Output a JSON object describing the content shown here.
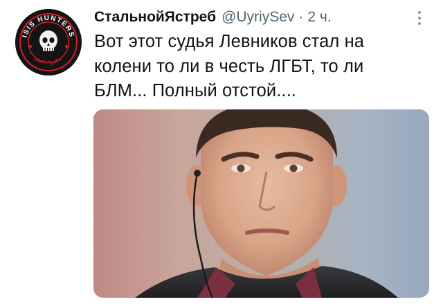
{
  "tweet": {
    "author": {
      "display_name": "СтальнойЯстреб",
      "handle": "@UyriySev",
      "avatar_icon": "skull-badge-avatar",
      "avatar_text_top": "ISIS HUNTERS",
      "avatar_text_bottom": "صائدوا داعش"
    },
    "separator": "·",
    "time": "2 ч.",
    "text": "Вот этот судья Левников стал на колени то ли в честь ЛГБТ, то ли БЛМ... Полный отстой....",
    "more_icon": "more-vertical-icon",
    "media": {
      "kind": "photo",
      "subject": "referee-portrait-photo"
    }
  },
  "colors": {
    "text_primary": "#0f1419",
    "text_secondary": "#536471",
    "avatar_accent": "#d21f26"
  }
}
